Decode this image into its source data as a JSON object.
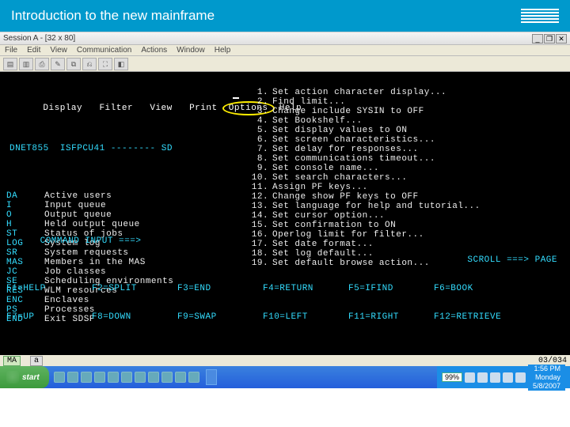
{
  "header": {
    "title": "Introduction to the new mainframe",
    "logo": "IBM"
  },
  "emulator": {
    "titlebar": "Session A - [32 x 80]",
    "menu": [
      "File",
      "Edit",
      "View",
      "Communication",
      "Actions",
      "Window",
      "Help"
    ],
    "win_controls": {
      "min": "_",
      "restore": "❐",
      "close": "✕"
    }
  },
  "terminal": {
    "menubar": [
      "Display",
      "Filter",
      "View",
      "Print",
      "Options",
      "Help"
    ],
    "session_header": "DNET855  ISFPCU41 -------- SD",
    "left_items": [
      {
        "code": "DA",
        "label": "Active users"
      },
      {
        "code": "I",
        "label": "Input queue"
      },
      {
        "code": "O",
        "label": "Output queue"
      },
      {
        "code": "H",
        "label": "Held output queue"
      },
      {
        "code": "ST",
        "label": "Status of jobs"
      },
      {
        "code": "",
        "label": ""
      },
      {
        "code": "LOG",
        "label": "System log"
      },
      {
        "code": "SR",
        "label": "System requests"
      },
      {
        "code": "MAS",
        "label": "Members in the MAS"
      },
      {
        "code": "JC",
        "label": "Job classes"
      },
      {
        "code": "SE",
        "label": "Scheduling environments"
      },
      {
        "code": "RES",
        "label": "WLM resources"
      },
      {
        "code": "ENC",
        "label": "Enclaves"
      },
      {
        "code": "PS",
        "label": "Processes"
      },
      {
        "code": "",
        "label": ""
      },
      {
        "code": "END",
        "label": "Exit SDSF"
      }
    ],
    "right_items": [
      {
        "n": "1",
        "t": "Set action character display..."
      },
      {
        "n": "2",
        "t": "Find limit..."
      },
      {
        "n": "3",
        "t": "Change include SYSIN to OFF"
      },
      {
        "n": "4",
        "t": "Set Bookshelf..."
      },
      {
        "n": "5",
        "t": "Set display values to ON"
      },
      {
        "n": "6",
        "t": "Set screen characteristics..."
      },
      {
        "n": "7",
        "t": "Set delay for responses..."
      },
      {
        "n": "8",
        "t": "Set communications timeout..."
      },
      {
        "n": "9",
        "t": "Set console name..."
      },
      {
        "n": "10",
        "t": "Set search characters..."
      },
      {
        "n": "11",
        "t": "Assign PF keys..."
      },
      {
        "n": "12",
        "t": "Change show PF keys to OFF"
      },
      {
        "n": "13",
        "t": "Set language for help and tutorial..."
      },
      {
        "n": "14",
        "t": "Set cursor option..."
      },
      {
        "n": "15",
        "t": "Set confirmation to ON"
      },
      {
        "n": "16",
        "t": "Operlog limit for filter..."
      },
      {
        "n": "17",
        "t": "Set date format..."
      },
      {
        "n": "18",
        "t": "Set log default..."
      },
      {
        "n": "19",
        "t": "Set default browse action..."
      }
    ],
    "command_label": "COMMAND INPUT ===>",
    "scroll_label": "SCROLL ===> PAGE",
    "fkeys_row1": [
      "F1=HELP",
      "F2=SPLIT",
      "F3=END",
      "F4=RETURN",
      "F5=IFIND",
      "F6=BOOK"
    ],
    "fkeys_row2": [
      "F7=UP",
      "F8=DOWN",
      "F9=SWAP",
      "F10=LEFT",
      "F11=RIGHT",
      "F12=RETRIEVE"
    ]
  },
  "statusbar": {
    "left1": "MA",
    "left2": "a",
    "cursor": "03/034"
  },
  "taskbar": {
    "start": "start",
    "pct": "99%",
    "time": "1:56 PM",
    "date": "5/8/2007",
    "day": "Monday"
  }
}
